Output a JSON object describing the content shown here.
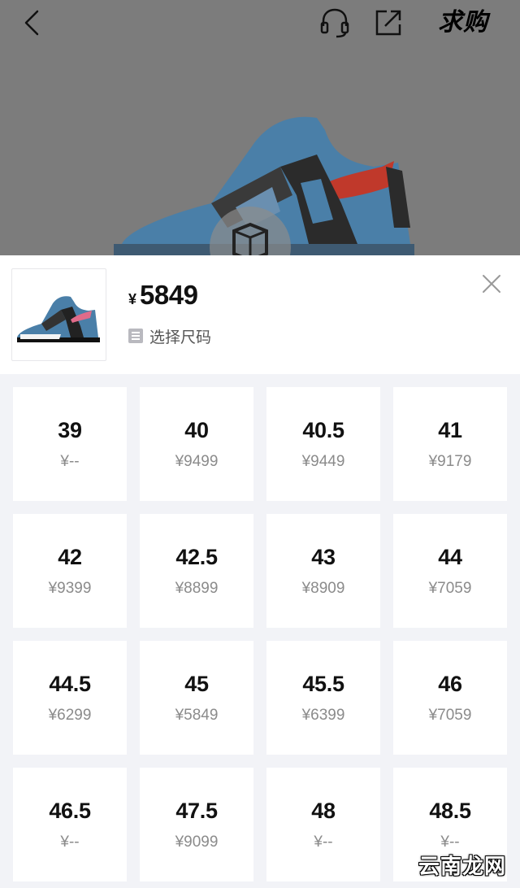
{
  "topbar": {
    "buy_label": "求购"
  },
  "icons": {
    "back": "chevron-left-icon",
    "service": "headset-icon",
    "share": "share-icon",
    "close": "close-icon",
    "hint": "list-icon"
  },
  "product": {
    "currency": "¥",
    "price": "5849",
    "size_hint": "选择尺码"
  },
  "sizes": [
    {
      "size": "39",
      "price": "¥--"
    },
    {
      "size": "40",
      "price": "¥9499"
    },
    {
      "size": "40.5",
      "price": "¥9449"
    },
    {
      "size": "41",
      "price": "¥9179"
    },
    {
      "size": "42",
      "price": "¥9399"
    },
    {
      "size": "42.5",
      "price": "¥8899"
    },
    {
      "size": "43",
      "price": "¥8909"
    },
    {
      "size": "44",
      "price": "¥7059"
    },
    {
      "size": "44.5",
      "price": "¥6299"
    },
    {
      "size": "45",
      "price": "¥5849"
    },
    {
      "size": "45.5",
      "price": "¥6399"
    },
    {
      "size": "46",
      "price": "¥7059"
    },
    {
      "size": "46.5",
      "price": "¥--"
    },
    {
      "size": "47.5",
      "price": "¥9099"
    },
    {
      "size": "48",
      "price": "¥--"
    },
    {
      "size": "48.5",
      "price": "¥--"
    }
  ],
  "watermark": "云南龙网",
  "colors": {
    "overlay": "#7c7c7c",
    "shoe_blue": "#4a7fa8",
    "shoe_red": "#c0392b",
    "sheet_bg": "#f2f3f7"
  }
}
